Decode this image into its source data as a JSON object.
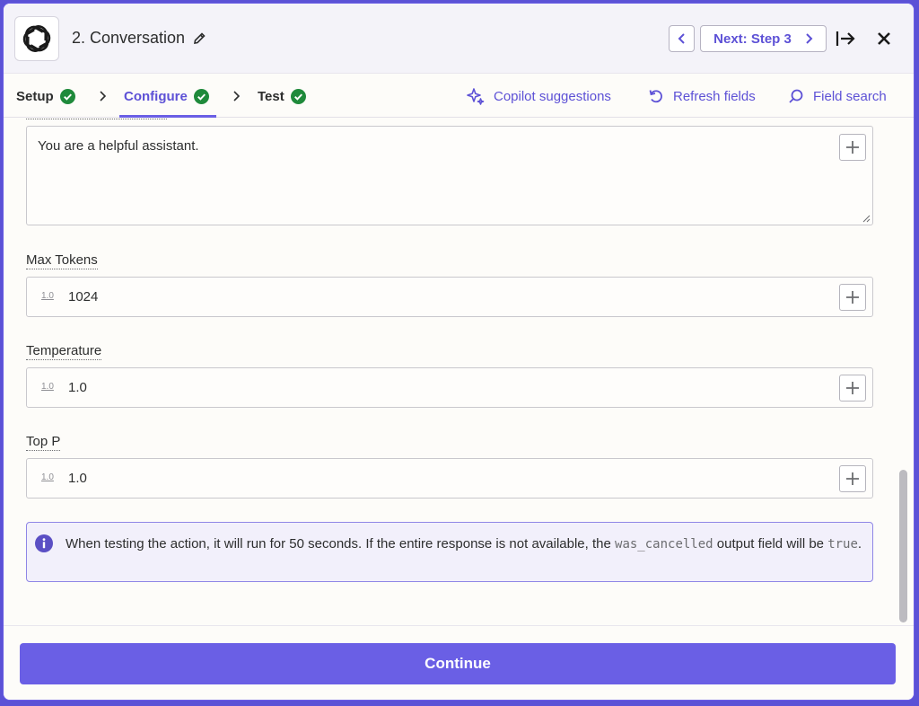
{
  "header": {
    "step_title": "2. Conversation",
    "next_label": "Next: Step 3"
  },
  "tabs": [
    {
      "label": "Setup",
      "status": "complete"
    },
    {
      "label": "Configure",
      "status": "complete",
      "active": true
    },
    {
      "label": "Test",
      "status": "complete"
    }
  ],
  "tools": {
    "copilot": "Copilot suggestions",
    "refresh": "Refresh fields",
    "search": "Field search"
  },
  "system_message": {
    "value": "You are a helpful assistant."
  },
  "fields": [
    {
      "label": "Max Tokens",
      "type_icon": "1.0",
      "value": "1024"
    },
    {
      "label": "Temperature",
      "type_icon": "1.0",
      "value": "1.0"
    },
    {
      "label": "Top P",
      "type_icon": "1.0",
      "value": "1.0"
    }
  ],
  "info": {
    "text_before": "When testing the action, it will run for 50 seconds. If the entire response is not available, the",
    "code1": "was_cancelled",
    "text_middle": "output field will be",
    "code2": "true",
    "text_after": "."
  },
  "footer": {
    "continue_label": "Continue"
  },
  "colors": {
    "accent": "#6a5fe5",
    "success": "#1f8a3b"
  }
}
